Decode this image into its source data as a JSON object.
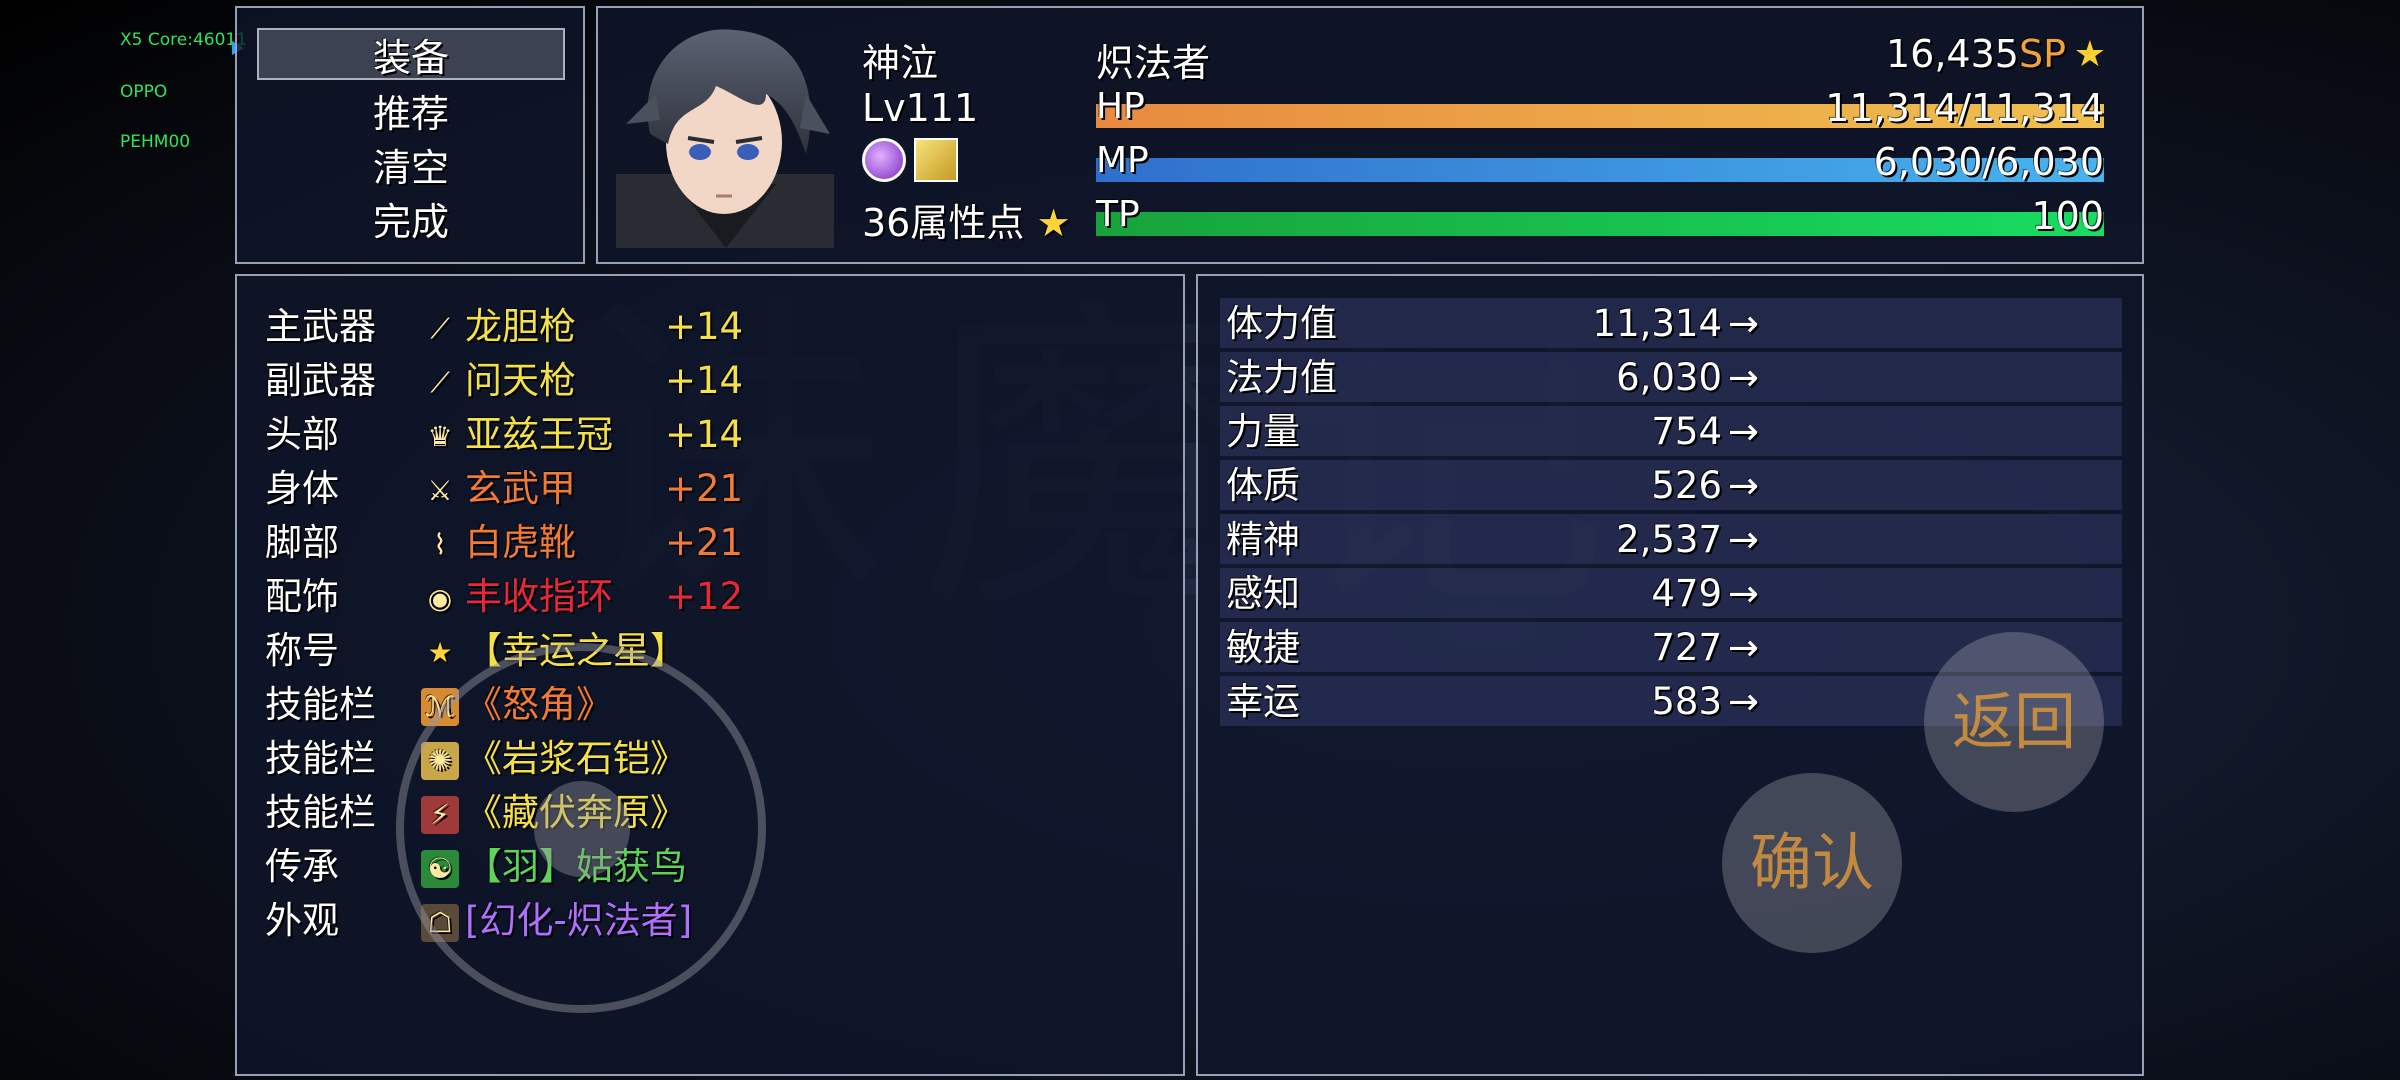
{
  "debug": {
    "line1": "X5 Core:46011",
    "line2": "OPPO",
    "line3": "PEHM00"
  },
  "background_title": "诛魔记",
  "commands": [
    {
      "label": "装备",
      "selected": true
    },
    {
      "label": "推荐",
      "selected": false
    },
    {
      "label": "清空",
      "selected": false
    },
    {
      "label": "完成",
      "selected": false
    }
  ],
  "actor": {
    "name": "神泣",
    "class": "炽法者",
    "level": "Lv111",
    "points": "36属性点",
    "sp_value": "16,435",
    "sp_unit": "SP",
    "hp_label": "HP",
    "hp_value": "11,314/11,314",
    "hp_rate": 1.0,
    "mp_label": "MP",
    "mp_value": "6,030/6,030",
    "mp_rate": 1.0,
    "tp_label": "TP",
    "tp_value": "100",
    "tp_rate": 1.0
  },
  "colors": {
    "hp_a": "#e88a3e",
    "hp_b": "#f0c050",
    "mp_a": "#2f6fcc",
    "mp_b": "#48b3ee",
    "tp_a": "#18a23c",
    "tp_b": "#18dc62"
  },
  "equipment": [
    {
      "slot": "主武器",
      "name": "龙胆枪",
      "plus": "+14",
      "color": "#f3e04a",
      "icon": "spear-icon"
    },
    {
      "slot": "副武器",
      "name": "问天枪",
      "plus": "+14",
      "color": "#f3e04a",
      "icon": "spear-icon"
    },
    {
      "slot": "头部",
      "name": "亚兹王冠",
      "plus": "+14",
      "color": "#f3e04a",
      "icon": "crown-icon"
    },
    {
      "slot": "身体",
      "name": "玄武甲",
      "plus": "+21",
      "color": "#f07a36",
      "icon": "armor-icon"
    },
    {
      "slot": "脚部",
      "name": "白虎靴",
      "plus": "+21",
      "color": "#f07a36",
      "icon": "boots-icon"
    },
    {
      "slot": "配饰",
      "name": "丰收指环",
      "plus": "+12",
      "color": "#e8283a",
      "icon": "ring-icon"
    },
    {
      "slot": "称号",
      "name": "【幸运之星】",
      "plus": "",
      "color": "#f3e04a",
      "icon": "star-icon"
    },
    {
      "slot": "技能栏",
      "name": "《怒角》",
      "plus": "",
      "color": "#f07a36",
      "icon": "horn-skill-icon"
    },
    {
      "slot": "技能栏",
      "name": "《岩浆石铠》",
      "plus": "",
      "color": "#f3e04a",
      "icon": "rock-skill-icon"
    },
    {
      "slot": "技能栏",
      "name": "《藏伏奔原》",
      "plus": "",
      "color": "#f3e04a",
      "icon": "ambush-skill-icon"
    },
    {
      "slot": "传承",
      "name": "【羽】姑获鸟",
      "plus": "",
      "color": "#5ed45a",
      "icon": "bird-icon"
    },
    {
      "slot": "外观",
      "name": "[幻化-炽法者]",
      "plus": "",
      "color": "#b070ff",
      "icon": "mask-icon"
    }
  ],
  "params": [
    {
      "name": "体力值",
      "value": "11,314"
    },
    {
      "name": "法力值",
      "value": "6,030"
    },
    {
      "name": "力量",
      "value": "754"
    },
    {
      "name": "体质",
      "value": "526"
    },
    {
      "name": "精神",
      "value": "2,537"
    },
    {
      "name": "感知",
      "value": "479"
    },
    {
      "name": "敏捷",
      "value": "727"
    },
    {
      "name": "幸运",
      "value": "583"
    }
  ],
  "arrow": "→",
  "buttons": {
    "back": "返回",
    "confirm": "确认"
  }
}
